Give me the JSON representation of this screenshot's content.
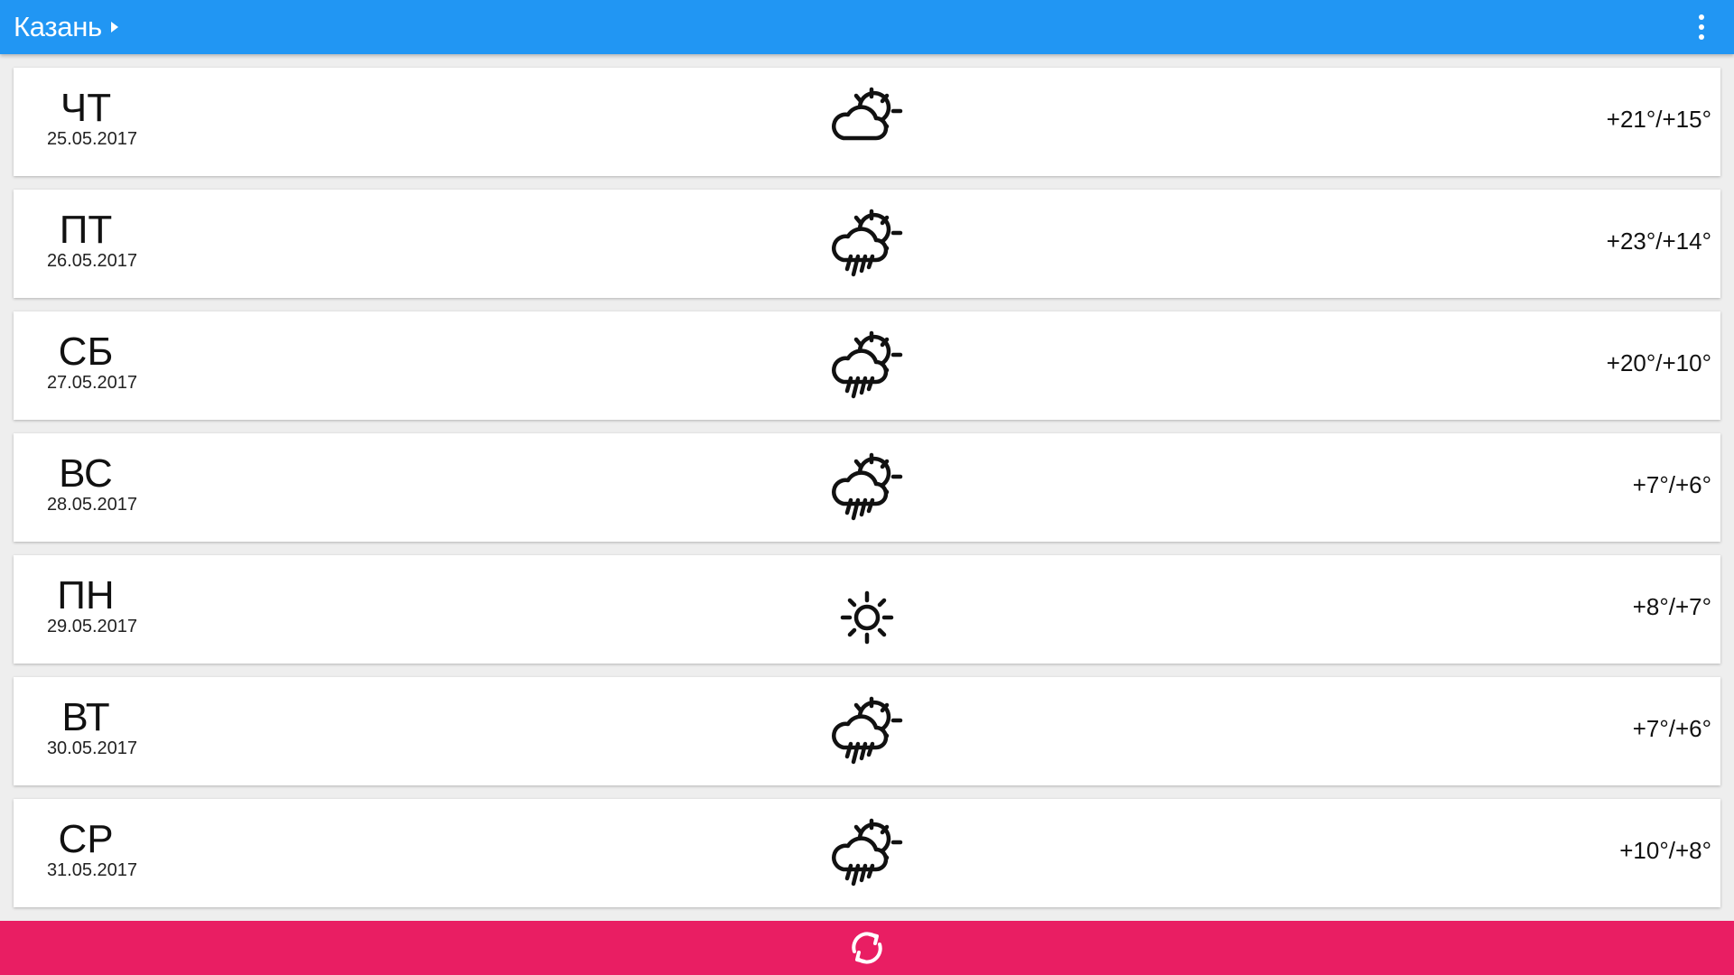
{
  "header": {
    "city": "Казань",
    "dropdown_icon": "triangle-right-icon",
    "menu_icon": "more-vert-icon",
    "bar_color": "#2196f3"
  },
  "forecast": [
    {
      "day": "ЧТ",
      "date": "25.05.2017",
      "icon": "partly-cloudy-icon",
      "temp": "+21°/+15°"
    },
    {
      "day": "ПТ",
      "date": "26.05.2017",
      "icon": "partly-cloudy-rain-icon",
      "temp": "+23°/+14°"
    },
    {
      "day": "СБ",
      "date": "27.05.2017",
      "icon": "partly-cloudy-rain-icon",
      "temp": "+20°/+10°"
    },
    {
      "day": "ВС",
      "date": "28.05.2017",
      "icon": "partly-cloudy-rain-icon",
      "temp": "+7°/+6°"
    },
    {
      "day": "ПН",
      "date": "29.05.2017",
      "icon": "sun-icon",
      "temp": "+8°/+7°"
    },
    {
      "day": "ВТ",
      "date": "30.05.2017",
      "icon": "partly-cloudy-rain-icon",
      "temp": "+7°/+6°"
    },
    {
      "day": "СР",
      "date": "31.05.2017",
      "icon": "partly-cloudy-rain-icon",
      "temp": "+10°/+8°"
    }
  ],
  "footer": {
    "refresh_icon": "refresh-icon",
    "bar_color": "#e91e63"
  }
}
